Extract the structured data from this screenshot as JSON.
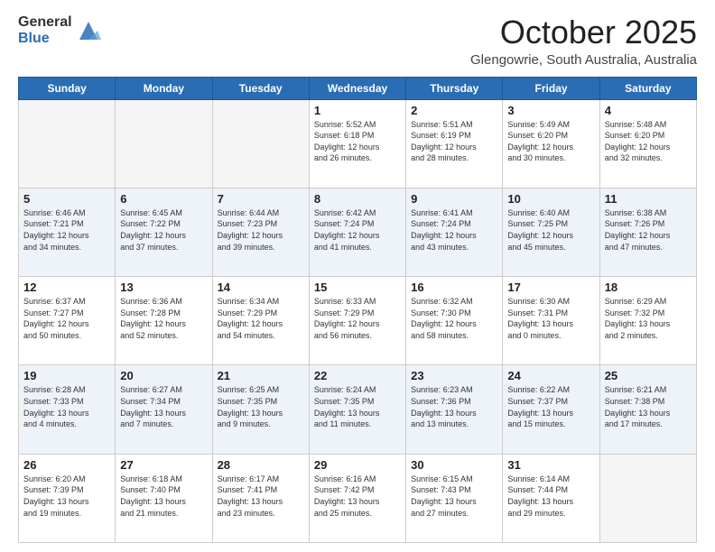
{
  "header": {
    "logo_general": "General",
    "logo_blue": "Blue",
    "month_title": "October 2025",
    "location": "Glengowrie, South Australia, Australia"
  },
  "days_of_week": [
    "Sunday",
    "Monday",
    "Tuesday",
    "Wednesday",
    "Thursday",
    "Friday",
    "Saturday"
  ],
  "weeks": [
    {
      "alt": false,
      "days": [
        {
          "num": "",
          "info": ""
        },
        {
          "num": "",
          "info": ""
        },
        {
          "num": "",
          "info": ""
        },
        {
          "num": "1",
          "info": "Sunrise: 5:52 AM\nSunset: 6:18 PM\nDaylight: 12 hours\nand 26 minutes."
        },
        {
          "num": "2",
          "info": "Sunrise: 5:51 AM\nSunset: 6:19 PM\nDaylight: 12 hours\nand 28 minutes."
        },
        {
          "num": "3",
          "info": "Sunrise: 5:49 AM\nSunset: 6:20 PM\nDaylight: 12 hours\nand 30 minutes."
        },
        {
          "num": "4",
          "info": "Sunrise: 5:48 AM\nSunset: 6:20 PM\nDaylight: 12 hours\nand 32 minutes."
        }
      ]
    },
    {
      "alt": true,
      "days": [
        {
          "num": "5",
          "info": "Sunrise: 6:46 AM\nSunset: 7:21 PM\nDaylight: 12 hours\nand 34 minutes."
        },
        {
          "num": "6",
          "info": "Sunrise: 6:45 AM\nSunset: 7:22 PM\nDaylight: 12 hours\nand 37 minutes."
        },
        {
          "num": "7",
          "info": "Sunrise: 6:44 AM\nSunset: 7:23 PM\nDaylight: 12 hours\nand 39 minutes."
        },
        {
          "num": "8",
          "info": "Sunrise: 6:42 AM\nSunset: 7:24 PM\nDaylight: 12 hours\nand 41 minutes."
        },
        {
          "num": "9",
          "info": "Sunrise: 6:41 AM\nSunset: 7:24 PM\nDaylight: 12 hours\nand 43 minutes."
        },
        {
          "num": "10",
          "info": "Sunrise: 6:40 AM\nSunset: 7:25 PM\nDaylight: 12 hours\nand 45 minutes."
        },
        {
          "num": "11",
          "info": "Sunrise: 6:38 AM\nSunset: 7:26 PM\nDaylight: 12 hours\nand 47 minutes."
        }
      ]
    },
    {
      "alt": false,
      "days": [
        {
          "num": "12",
          "info": "Sunrise: 6:37 AM\nSunset: 7:27 PM\nDaylight: 12 hours\nand 50 minutes."
        },
        {
          "num": "13",
          "info": "Sunrise: 6:36 AM\nSunset: 7:28 PM\nDaylight: 12 hours\nand 52 minutes."
        },
        {
          "num": "14",
          "info": "Sunrise: 6:34 AM\nSunset: 7:29 PM\nDaylight: 12 hours\nand 54 minutes."
        },
        {
          "num": "15",
          "info": "Sunrise: 6:33 AM\nSunset: 7:29 PM\nDaylight: 12 hours\nand 56 minutes."
        },
        {
          "num": "16",
          "info": "Sunrise: 6:32 AM\nSunset: 7:30 PM\nDaylight: 12 hours\nand 58 minutes."
        },
        {
          "num": "17",
          "info": "Sunrise: 6:30 AM\nSunset: 7:31 PM\nDaylight: 13 hours\nand 0 minutes."
        },
        {
          "num": "18",
          "info": "Sunrise: 6:29 AM\nSunset: 7:32 PM\nDaylight: 13 hours\nand 2 minutes."
        }
      ]
    },
    {
      "alt": true,
      "days": [
        {
          "num": "19",
          "info": "Sunrise: 6:28 AM\nSunset: 7:33 PM\nDaylight: 13 hours\nand 4 minutes."
        },
        {
          "num": "20",
          "info": "Sunrise: 6:27 AM\nSunset: 7:34 PM\nDaylight: 13 hours\nand 7 minutes."
        },
        {
          "num": "21",
          "info": "Sunrise: 6:25 AM\nSunset: 7:35 PM\nDaylight: 13 hours\nand 9 minutes."
        },
        {
          "num": "22",
          "info": "Sunrise: 6:24 AM\nSunset: 7:35 PM\nDaylight: 13 hours\nand 11 minutes."
        },
        {
          "num": "23",
          "info": "Sunrise: 6:23 AM\nSunset: 7:36 PM\nDaylight: 13 hours\nand 13 minutes."
        },
        {
          "num": "24",
          "info": "Sunrise: 6:22 AM\nSunset: 7:37 PM\nDaylight: 13 hours\nand 15 minutes."
        },
        {
          "num": "25",
          "info": "Sunrise: 6:21 AM\nSunset: 7:38 PM\nDaylight: 13 hours\nand 17 minutes."
        }
      ]
    },
    {
      "alt": false,
      "days": [
        {
          "num": "26",
          "info": "Sunrise: 6:20 AM\nSunset: 7:39 PM\nDaylight: 13 hours\nand 19 minutes."
        },
        {
          "num": "27",
          "info": "Sunrise: 6:18 AM\nSunset: 7:40 PM\nDaylight: 13 hours\nand 21 minutes."
        },
        {
          "num": "28",
          "info": "Sunrise: 6:17 AM\nSunset: 7:41 PM\nDaylight: 13 hours\nand 23 minutes."
        },
        {
          "num": "29",
          "info": "Sunrise: 6:16 AM\nSunset: 7:42 PM\nDaylight: 13 hours\nand 25 minutes."
        },
        {
          "num": "30",
          "info": "Sunrise: 6:15 AM\nSunset: 7:43 PM\nDaylight: 13 hours\nand 27 minutes."
        },
        {
          "num": "31",
          "info": "Sunrise: 6:14 AM\nSunset: 7:44 PM\nDaylight: 13 hours\nand 29 minutes."
        },
        {
          "num": "",
          "info": ""
        }
      ]
    }
  ]
}
